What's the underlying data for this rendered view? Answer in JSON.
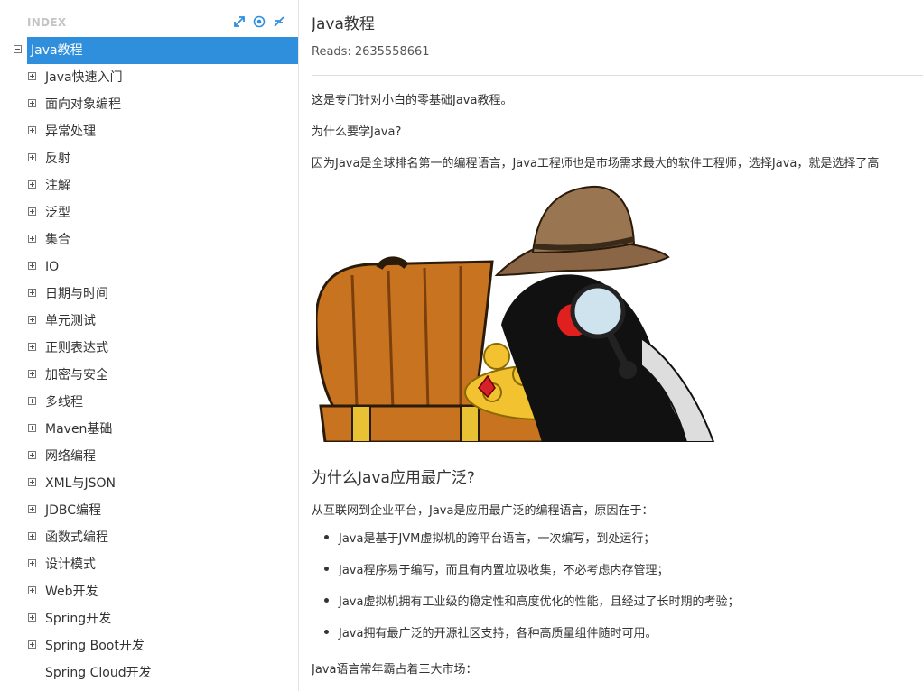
{
  "sidebar": {
    "title": "INDEX",
    "tools": [
      "expand-icon",
      "locate-icon",
      "collapse-icon"
    ],
    "accent": "#2f8fdc",
    "root": {
      "label": "Java教程"
    },
    "items": [
      {
        "label": "Java快速入门",
        "expandable": true
      },
      {
        "label": "面向对象编程",
        "expandable": true
      },
      {
        "label": "异常处理",
        "expandable": true
      },
      {
        "label": "反射",
        "expandable": true
      },
      {
        "label": "注解",
        "expandable": true
      },
      {
        "label": "泛型",
        "expandable": true
      },
      {
        "label": "集合",
        "expandable": true
      },
      {
        "label": "IO",
        "expandable": true
      },
      {
        "label": "日期与时间",
        "expandable": true
      },
      {
        "label": "单元测试",
        "expandable": true
      },
      {
        "label": "正则表达式",
        "expandable": true
      },
      {
        "label": "加密与安全",
        "expandable": true
      },
      {
        "label": "多线程",
        "expandable": true
      },
      {
        "label": "Maven基础",
        "expandable": true
      },
      {
        "label": "网络编程",
        "expandable": true
      },
      {
        "label": "XML与JSON",
        "expandable": true
      },
      {
        "label": "JDBC编程",
        "expandable": true
      },
      {
        "label": "函数式编程",
        "expandable": true
      },
      {
        "label": "设计模式",
        "expandable": true
      },
      {
        "label": "Web开发",
        "expandable": true
      },
      {
        "label": "Spring开发",
        "expandable": true
      },
      {
        "label": "Spring Boot开发",
        "expandable": true
      },
      {
        "label": "Spring Cloud开发",
        "expandable": false
      }
    ]
  },
  "article": {
    "title": "Java教程",
    "reads_label": "Reads:",
    "reads_value": "2635558661",
    "para1": "这是专门针对小白的零基础Java教程。",
    "para2": "为什么要学Java?",
    "para3": "因为Java是全球排名第一的编程语言，Java工程师也是市场需求最大的软件工程师，选择Java，就是选择了高",
    "heading2": "为什么Java应用最广泛?",
    "para4": "从互联网到企业平台，Java是应用最广泛的编程语言，原因在于：",
    "bullets": [
      "Java是基于JVM虚拟机的跨平台语言，一次编写，到处运行；",
      "Java程序易于编写，而且有内置垃圾收集，不必考虑内存管理；",
      "Java虚拟机拥有工业级的稳定性和高度优化的性能，且经过了长时期的考验；",
      "Java拥有最广泛的开源社区支持，各种高质量组件随时可用。"
    ],
    "para5": "Java语言常年霸占着三大市场："
  }
}
